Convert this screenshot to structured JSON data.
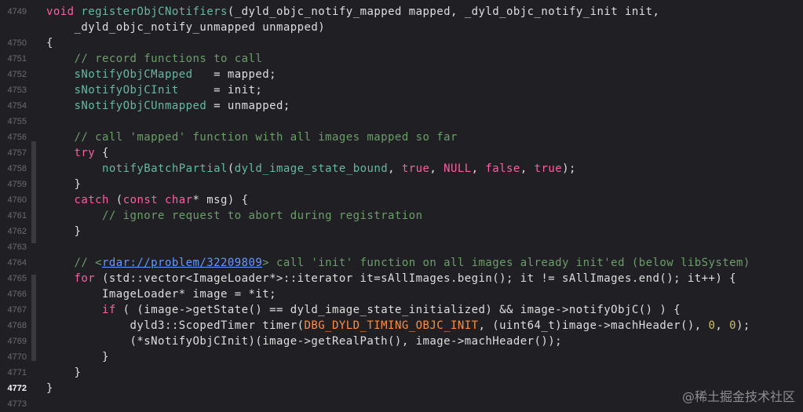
{
  "editor": {
    "current_line": "4772",
    "lines": [
      {
        "num": "4749",
        "tokens": [
          {
            "t": "void ",
            "c": "keyword"
          },
          {
            "t": "registerObjCNotifiers",
            "c": "func"
          },
          {
            "t": "(",
            "c": "plain"
          },
          {
            "t": "_dyld_objc_notify_mapped",
            "c": "plain"
          },
          {
            "t": " mapped, ",
            "c": "plain"
          },
          {
            "t": "_dyld_objc_notify_init",
            "c": "plain"
          },
          {
            "t": " init,",
            "c": "plain"
          }
        ]
      },
      {
        "num": "",
        "tokens": [
          {
            "t": "    _dyld_objc_notify_unmapped",
            "c": "plain"
          },
          {
            "t": " unmapped)",
            "c": "plain"
          }
        ]
      },
      {
        "num": "4750",
        "tokens": [
          {
            "t": "{",
            "c": "plain"
          }
        ]
      },
      {
        "num": "4751",
        "tokens": [
          {
            "t": "    // record functions to call",
            "c": "comment"
          }
        ]
      },
      {
        "num": "4752",
        "tokens": [
          {
            "t": "    sNotifyObjCMapped",
            "c": "var"
          },
          {
            "t": "   = mapped;",
            "c": "plain"
          }
        ]
      },
      {
        "num": "4753",
        "tokens": [
          {
            "t": "    sNotifyObjCInit",
            "c": "var"
          },
          {
            "t": "     = init;",
            "c": "plain"
          }
        ]
      },
      {
        "num": "4754",
        "tokens": [
          {
            "t": "    sNotifyObjCUnmapped",
            "c": "var"
          },
          {
            "t": " = unmapped;",
            "c": "plain"
          }
        ]
      },
      {
        "num": "4755",
        "tokens": []
      },
      {
        "num": "4756",
        "tokens": [
          {
            "t": "    // call 'mapped' function with all images mapped so far",
            "c": "comment"
          }
        ]
      },
      {
        "num": "4757",
        "tokens": [
          {
            "t": "    try",
            "c": "keyword"
          },
          {
            "t": " {",
            "c": "plain"
          }
        ]
      },
      {
        "num": "4758",
        "tokens": [
          {
            "t": "        notifyBatchPartial",
            "c": "func"
          },
          {
            "t": "(",
            "c": "plain"
          },
          {
            "t": "dyld_image_state_bound",
            "c": "func"
          },
          {
            "t": ", ",
            "c": "plain"
          },
          {
            "t": "true",
            "c": "keyword"
          },
          {
            "t": ", ",
            "c": "plain"
          },
          {
            "t": "NULL",
            "c": "keyword"
          },
          {
            "t": ", ",
            "c": "plain"
          },
          {
            "t": "false",
            "c": "keyword"
          },
          {
            "t": ", ",
            "c": "plain"
          },
          {
            "t": "true",
            "c": "keyword"
          },
          {
            "t": ");",
            "c": "plain"
          }
        ]
      },
      {
        "num": "4759",
        "tokens": [
          {
            "t": "    }",
            "c": "plain"
          }
        ]
      },
      {
        "num": "4760",
        "tokens": [
          {
            "t": "    catch",
            "c": "keyword"
          },
          {
            "t": " (",
            "c": "plain"
          },
          {
            "t": "const",
            "c": "keyword"
          },
          {
            "t": " ",
            "c": "plain"
          },
          {
            "t": "char",
            "c": "keyword"
          },
          {
            "t": "* msg) {",
            "c": "plain"
          }
        ]
      },
      {
        "num": "4761",
        "tokens": [
          {
            "t": "        // ignore request to abort during registration",
            "c": "comment"
          }
        ]
      },
      {
        "num": "4762",
        "tokens": [
          {
            "t": "    }",
            "c": "plain"
          }
        ]
      },
      {
        "num": "4763",
        "tokens": []
      },
      {
        "num": "4764",
        "tokens": [
          {
            "t": "    // <",
            "c": "comment"
          },
          {
            "t": "rdar://problem/32209809",
            "c": "link"
          },
          {
            "t": "> call 'init' function on all images already init'ed (below libSystem)",
            "c": "comment"
          }
        ]
      },
      {
        "num": "4765",
        "tokens": [
          {
            "t": "    for",
            "c": "keyword"
          },
          {
            "t": " (std::vector<ImageLoader*>::iterator it=sAllImages.begin(); it != sAllImages.end(); it++) {",
            "c": "plain"
          }
        ]
      },
      {
        "num": "4766",
        "tokens": [
          {
            "t": "        ImageLoader* image = *it;",
            "c": "plain"
          }
        ]
      },
      {
        "num": "4767",
        "tokens": [
          {
            "t": "        if",
            "c": "keyword"
          },
          {
            "t": " ( (image->getState() == dyld_image_state_initialized) && image->notifyObjC() ) {",
            "c": "plain"
          }
        ]
      },
      {
        "num": "4768",
        "tokens": [
          {
            "t": "            dyld3::ScopedTimer timer(",
            "c": "plain"
          },
          {
            "t": "DBG_DYLD_TIMING_OBJC_INIT",
            "c": "macro"
          },
          {
            "t": ", (uint64_t)image->machHeader(), ",
            "c": "plain"
          },
          {
            "t": "0",
            "c": "number"
          },
          {
            "t": ", ",
            "c": "plain"
          },
          {
            "t": "0",
            "c": "number"
          },
          {
            "t": ");",
            "c": "plain"
          }
        ]
      },
      {
        "num": "4769",
        "tokens": [
          {
            "t": "            (*sNotifyObjCInit)(image->getRealPath(), image->machHeader());",
            "c": "plain"
          }
        ]
      },
      {
        "num": "4770",
        "tokens": [
          {
            "t": "        }",
            "c": "plain"
          }
        ]
      },
      {
        "num": "4771",
        "tokens": [
          {
            "t": "    }",
            "c": "plain"
          }
        ]
      },
      {
        "num": "4772",
        "tokens": [
          {
            "t": "}",
            "c": "plain"
          }
        ]
      },
      {
        "num": "4773",
        "tokens": []
      }
    ]
  },
  "watermark": {
    "text": "@稀土掘金技术社区"
  }
}
